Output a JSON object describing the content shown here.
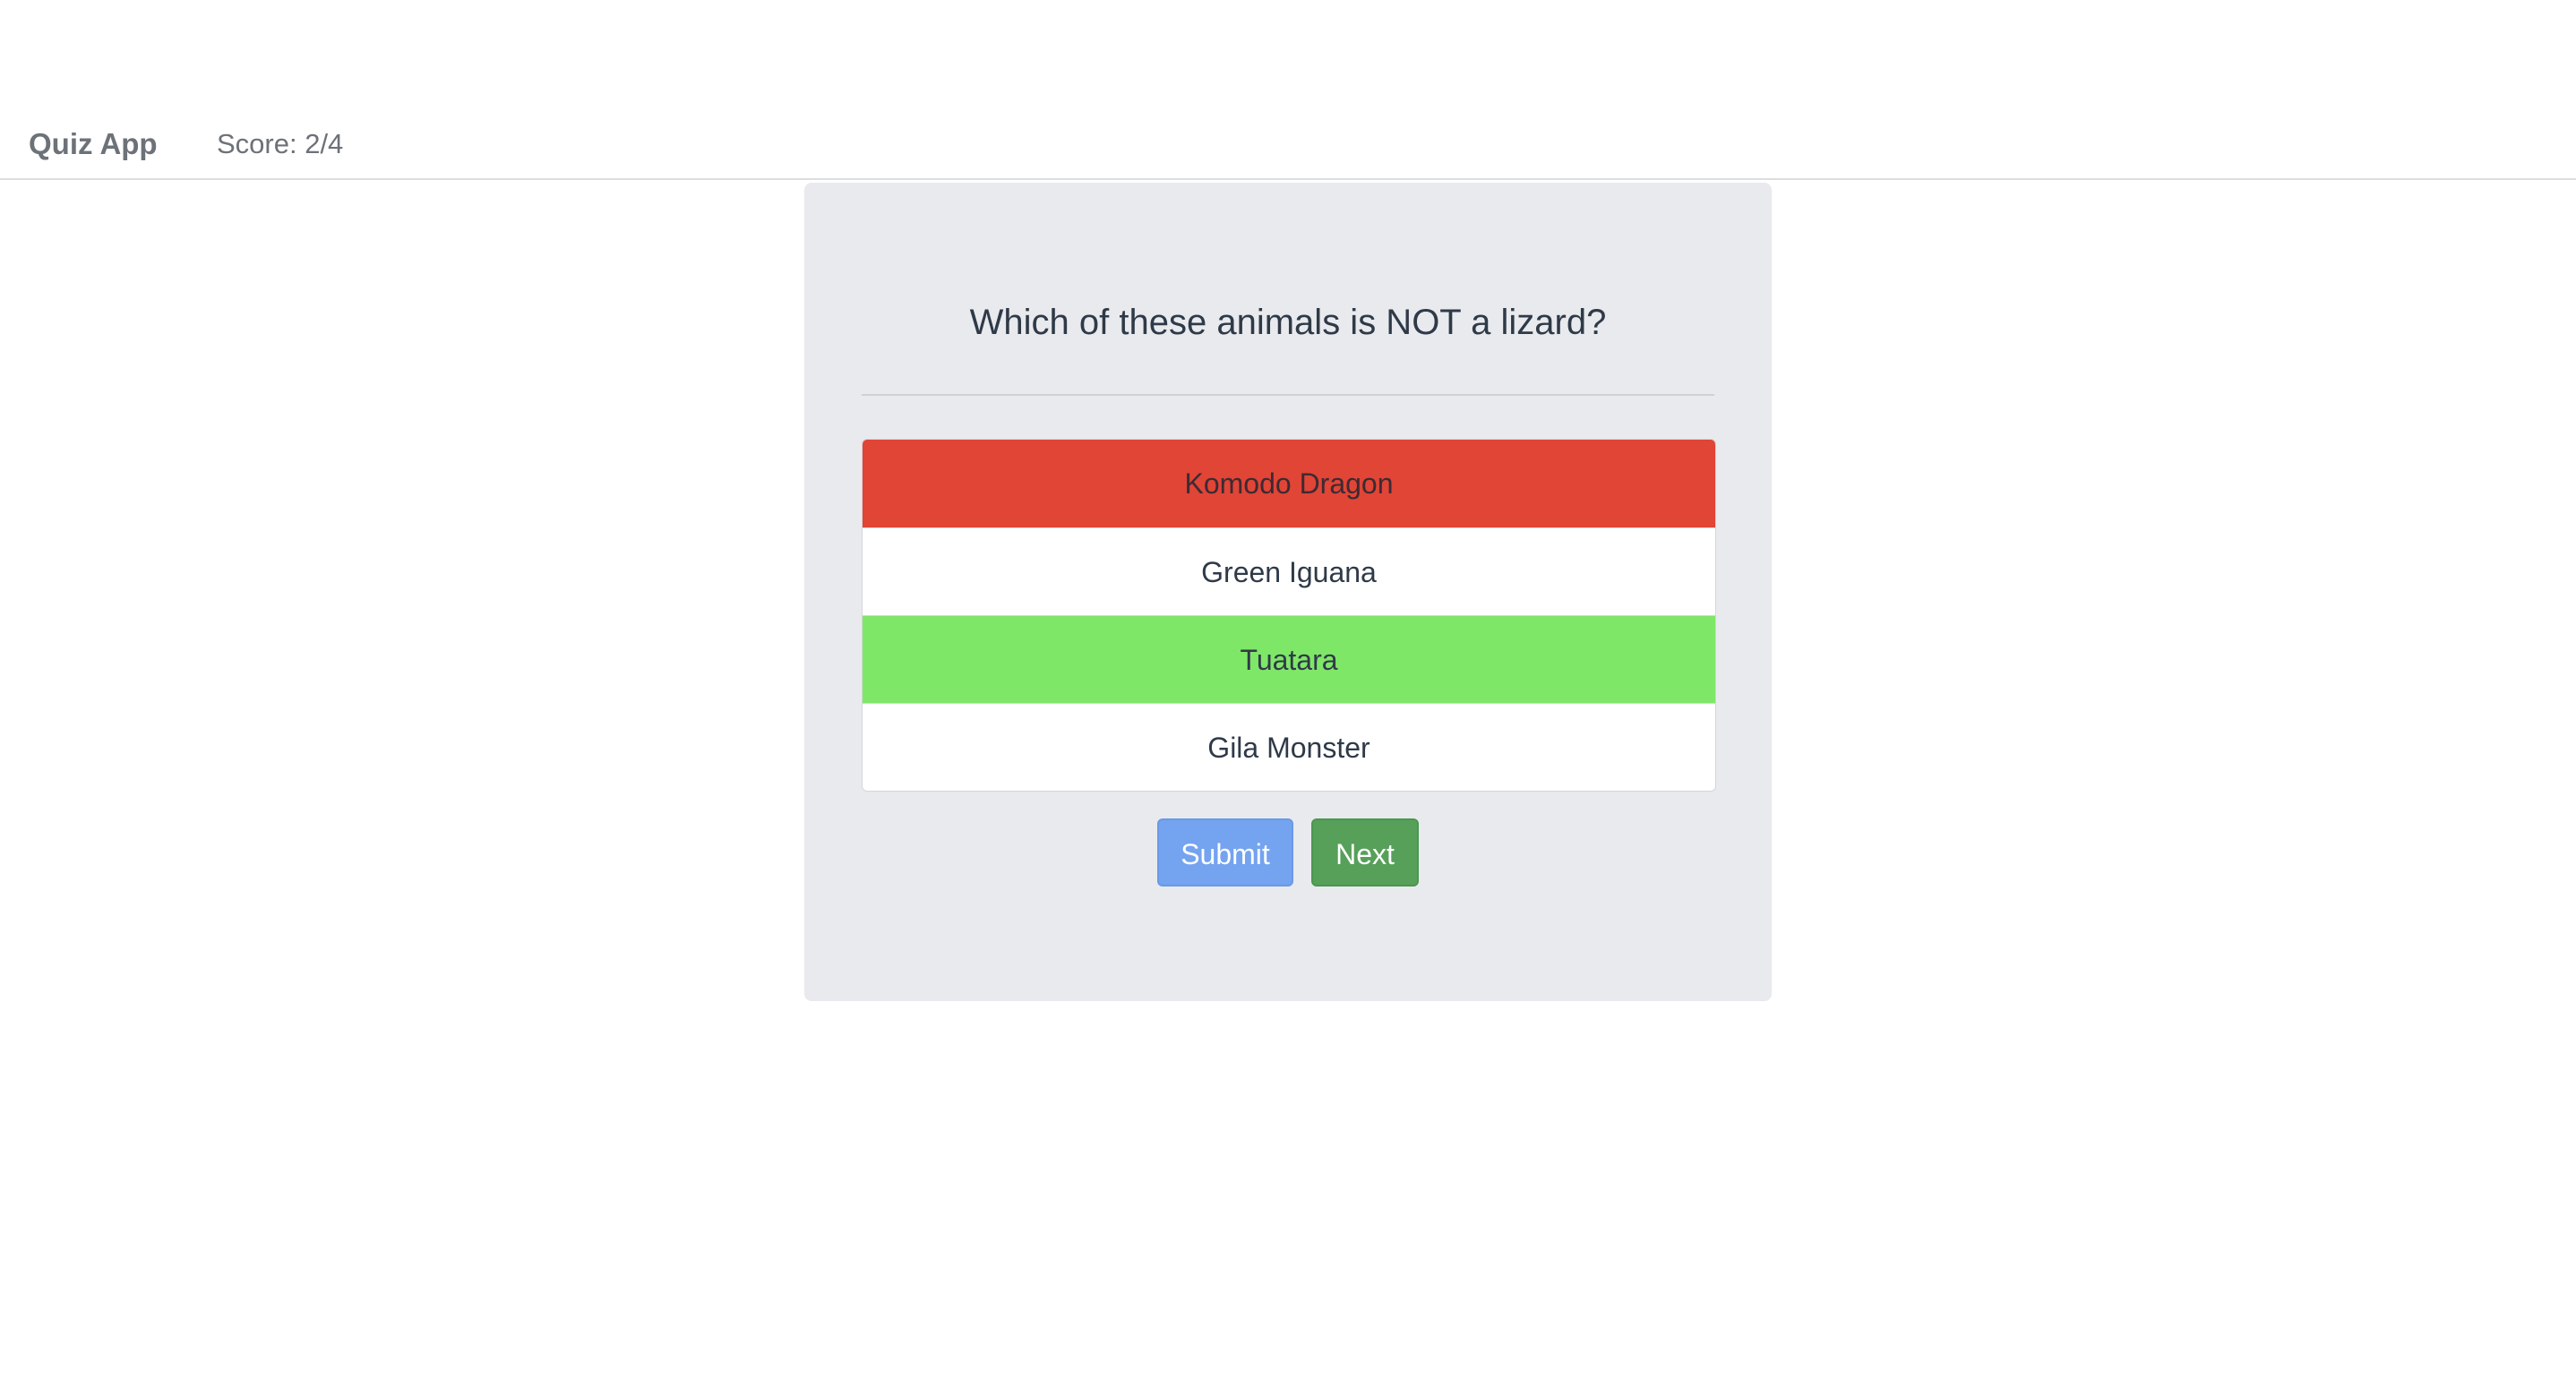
{
  "navbar": {
    "brand": "Quiz App",
    "score": "Score: 2/4"
  },
  "quiz": {
    "question": "Which of these animals is NOT a lizard?",
    "options": [
      {
        "label": "Komodo Dragon",
        "state": "wrong"
      },
      {
        "label": "Green Iguana",
        "state": "default"
      },
      {
        "label": "Tuatara",
        "state": "correct"
      },
      {
        "label": "Gila Monster",
        "state": "default"
      }
    ],
    "submit_label": "Submit",
    "next_label": "Next"
  },
  "colors": {
    "wrong": "#e04536",
    "correct": "#7fe767",
    "submit": "#74a3f0",
    "next": "#57a05a",
    "card": "#e9eaee"
  }
}
